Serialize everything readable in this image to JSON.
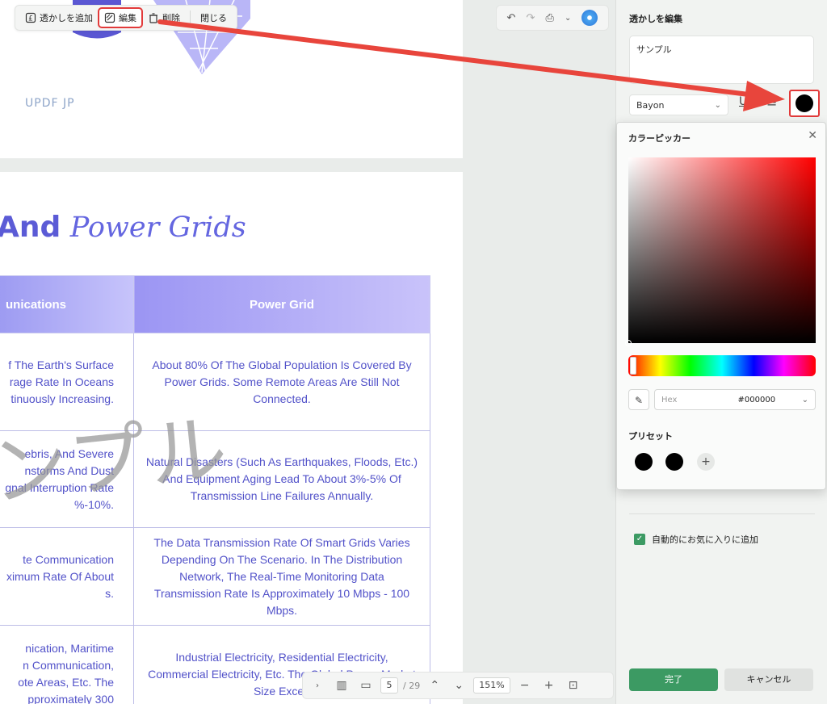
{
  "watermark_toolbar": {
    "add_label": "透かしを追加",
    "edit_label": "編集",
    "delete_label": "削除",
    "close_label": "閉じる"
  },
  "doc_toolbar": {
    "undo_icon": "undo-icon",
    "redo_icon": "redo-icon",
    "save_icon": "save-icon",
    "caret": "⌄"
  },
  "top_page": {
    "brand": "UPDF JP"
  },
  "main_page": {
    "title_bold": "And",
    "title_italic": "Power Grids",
    "watermark": "ンプル",
    "columns": [
      "unications",
      "Power Grid"
    ],
    "rows": [
      {
        "c1": [
          "f The Earth's Surface",
          "rage Rate In Oceans",
          "tinuously Increasing."
        ],
        "c2": "About 80% Of The Global Population Is Covered By Power Grids. Some Remote Areas Are Still Not Connected."
      },
      {
        "c1": [
          "ebris, And Severe",
          "nstorms And Dust",
          "gnal Interruption Rate",
          "%-10%."
        ],
        "c2": "Natural Disasters (Such As Earthquakes, Floods, Etc.) And Equipment Aging Lead To About 3%-5% Of Transmission Line Failures Annually."
      },
      {
        "c1": [
          "te Communication",
          "ximum Rate Of About",
          "s."
        ],
        "c2": "The Data Transmission Rate Of Smart Grids Varies Depending On The Scenario. In The Distribution Network, The Real-Time Monitoring Data Transmission Rate Is Approximately 10 Mbps - 100 Mbps."
      },
      {
        "c1": [
          "nication, Maritime",
          "n Communication,",
          "ote Areas, Etc. The",
          "pproximately 300"
        ],
        "c2": "Industrial Electricity, Residential Electricity, Commercial Electricity, Etc. The Global Power Market Size Excee"
      }
    ]
  },
  "nav_bar": {
    "current_page": "5",
    "total_pages": "/ 29",
    "zoom": "151%"
  },
  "right_panel": {
    "title": "透かしを編集",
    "text_value": "サンプル",
    "font": "Bayon",
    "auto_fav_label": "自動的にお気に入りに追加",
    "done_label": "完了",
    "cancel_label": "キャンセル",
    "selected_color": "#000000"
  },
  "color_picker": {
    "title": "カラーピッカー",
    "hex_label": "Hex",
    "hex_value": "#000000",
    "preset_label": "プリセット",
    "presets": [
      "#000000",
      "#000000"
    ],
    "hue": "#ff0000"
  },
  "colors": {
    "accent_green": "#3c9a63",
    "highlight_red": "#e23a3a",
    "title_blue": "#5b5bd6",
    "table_text": "#5252c9"
  }
}
